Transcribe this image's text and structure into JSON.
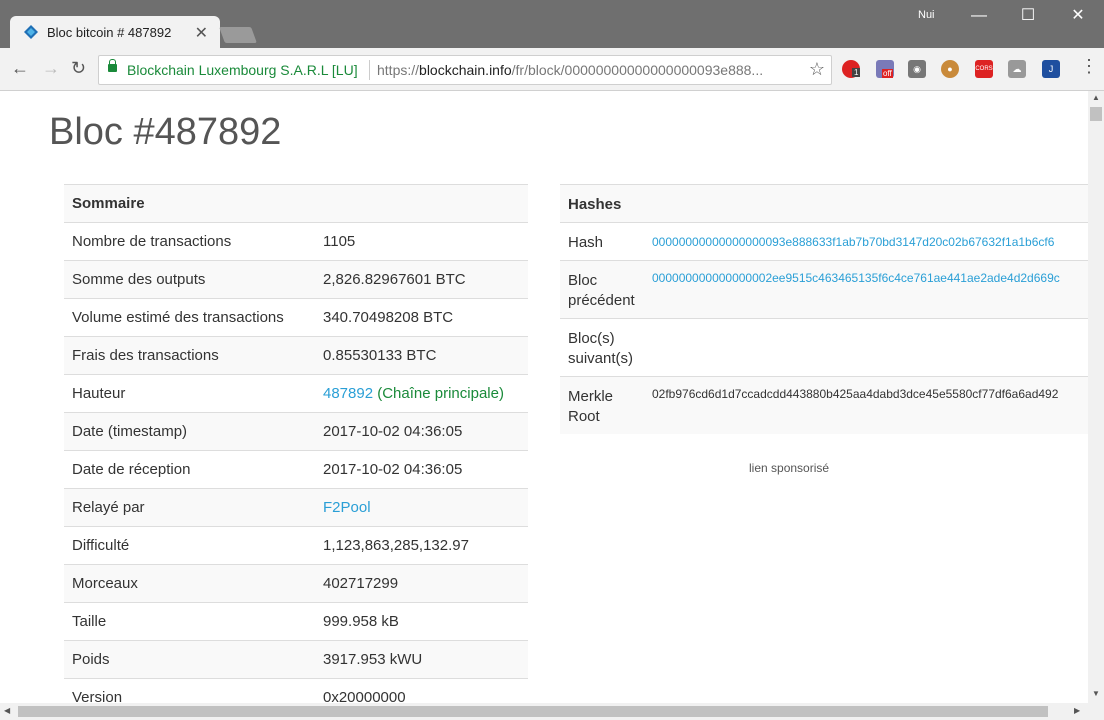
{
  "browser": {
    "tab_title": "Bloc bitcoin # 487892",
    "user": "Nui",
    "org": "Blockchain Luxembourg S.A.R.L [LU]",
    "url_prefix": "https://",
    "url_host": "blockchain.info",
    "url_path": "/fr/block/00000000000000000093e888...",
    "ext_badge_1": "1",
    "ext_badge_2": "off",
    "ext_cors": "CORS"
  },
  "page": {
    "title": "Bloc #487892",
    "summary_header": "Sommaire",
    "hashes_header": "Hashes",
    "sponsor": "lien sponsorisé"
  },
  "summary": [
    {
      "k": "Nombre de transactions",
      "v": "1105"
    },
    {
      "k": "Somme des outputs",
      "v": "2,826.82967601 BTC"
    },
    {
      "k": "Volume estimé des transactions",
      "v": "340.70498208 BTC"
    },
    {
      "k": "Frais des transactions",
      "v": "0.85530133 BTC"
    },
    {
      "k": "Hauteur",
      "v": "487892",
      "extra": "(Chaîne principale)"
    },
    {
      "k": "Date (timestamp)",
      "v": "2017-10-02 04:36:05"
    },
    {
      "k": "Date de réception",
      "v": "2017-10-02 04:36:05"
    },
    {
      "k": "Relayé par",
      "v": "F2Pool"
    },
    {
      "k": "Difficulté",
      "v": "1,123,863,285,132.97"
    },
    {
      "k": "Morceaux",
      "v": "402717299"
    },
    {
      "k": "Taille",
      "v": "999.958 kB"
    },
    {
      "k": "Poids",
      "v": "3917.953 kWU"
    },
    {
      "k": "Version",
      "v": "0x20000000"
    }
  ],
  "hashes": [
    {
      "k": "Hash",
      "v": "00000000000000000093e888633f1ab7b70bd3147d20c02b67632f1a1b6cf6"
    },
    {
      "k": "Bloc précédent",
      "v": "000000000000000002ee9515c463465135f6c4ce761ae441ae2ade4d2d669c"
    },
    {
      "k": "Bloc(s) suivant(s)",
      "v": ""
    },
    {
      "k": "Merkle Root",
      "v": "02fb976cd6d1d7ccadcdd443880b425aa4dabd3dce45e5580cf77df6a6ad492"
    }
  ]
}
